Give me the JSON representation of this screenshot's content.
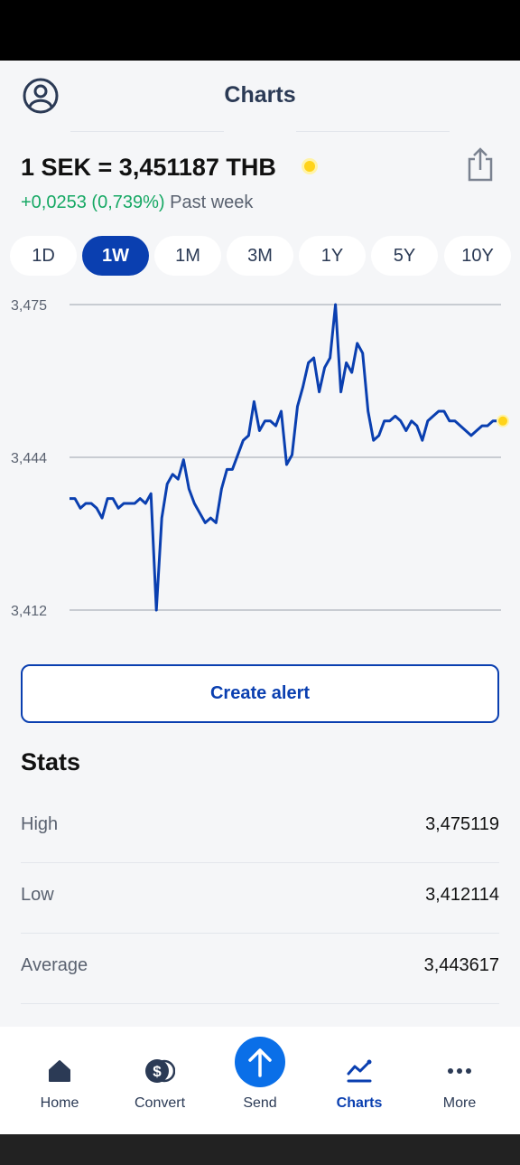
{
  "header": {
    "title": "Charts"
  },
  "rate": {
    "text": "1 SEK = 3,451187 THB",
    "change": "+0,0253 (0,739%)",
    "period": "Past week"
  },
  "periods": [
    {
      "label": "1D",
      "active": false
    },
    {
      "label": "1W",
      "active": true
    },
    {
      "label": "1M",
      "active": false
    },
    {
      "label": "3M",
      "active": false
    },
    {
      "label": "1Y",
      "active": false
    },
    {
      "label": "5Y",
      "active": false
    },
    {
      "label": "10Y",
      "active": false
    }
  ],
  "chart_data": {
    "type": "line",
    "yticks": [
      "3,475",
      "3,444",
      "3,412"
    ],
    "ylim": [
      3.412,
      3.475
    ],
    "grid": true,
    "series": [
      {
        "values": [
          3.435,
          3.435,
          3.433,
          3.434,
          3.434,
          3.433,
          3.431,
          3.435,
          3.435,
          3.433,
          3.434,
          3.434,
          3.434,
          3.435,
          3.434,
          3.436,
          3.412,
          3.431,
          3.438,
          3.44,
          3.439,
          3.443,
          3.437,
          3.434,
          3.432,
          3.43,
          3.431,
          3.43,
          3.437,
          3.441,
          3.441,
          3.444,
          3.447,
          3.448,
          3.455,
          3.449,
          3.451,
          3.451,
          3.45,
          3.453,
          3.442,
          3.444,
          3.454,
          3.458,
          3.463,
          3.464,
          3.457,
          3.462,
          3.464,
          3.475,
          3.457,
          3.463,
          3.461,
          3.467,
          3.465,
          3.453,
          3.447,
          3.448,
          3.451,
          3.451,
          3.452,
          3.451,
          3.449,
          3.451,
          3.45,
          3.447,
          3.451,
          3.452,
          3.453,
          3.453,
          3.451,
          3.451,
          3.45,
          3.449,
          3.448,
          3.449,
          3.45,
          3.45,
          3.451,
          3.451
        ]
      }
    ],
    "line_color": "#0a3fb0",
    "end_marker_color": "#ffd31a"
  },
  "actions": {
    "create_alert": "Create alert"
  },
  "stats": {
    "title": "Stats",
    "rows": [
      {
        "label": "High",
        "value": "3,475119"
      },
      {
        "label": "Low",
        "value": "3,412114"
      },
      {
        "label": "Average",
        "value": "3,443617"
      }
    ]
  },
  "nav": [
    {
      "label": "Home",
      "icon": "home-icon",
      "active": false
    },
    {
      "label": "Convert",
      "icon": "convert-icon",
      "active": false
    },
    {
      "label": "Send",
      "icon": "send-arrow-icon",
      "active": false
    },
    {
      "label": "Charts",
      "icon": "chart-line-icon",
      "active": true
    },
    {
      "label": "More",
      "icon": "more-dots-icon",
      "active": false
    }
  ],
  "colors": {
    "accent": "#0a3fb0",
    "positive": "#16a864",
    "send": "#0a6fe8",
    "live": "#ffd31a"
  }
}
